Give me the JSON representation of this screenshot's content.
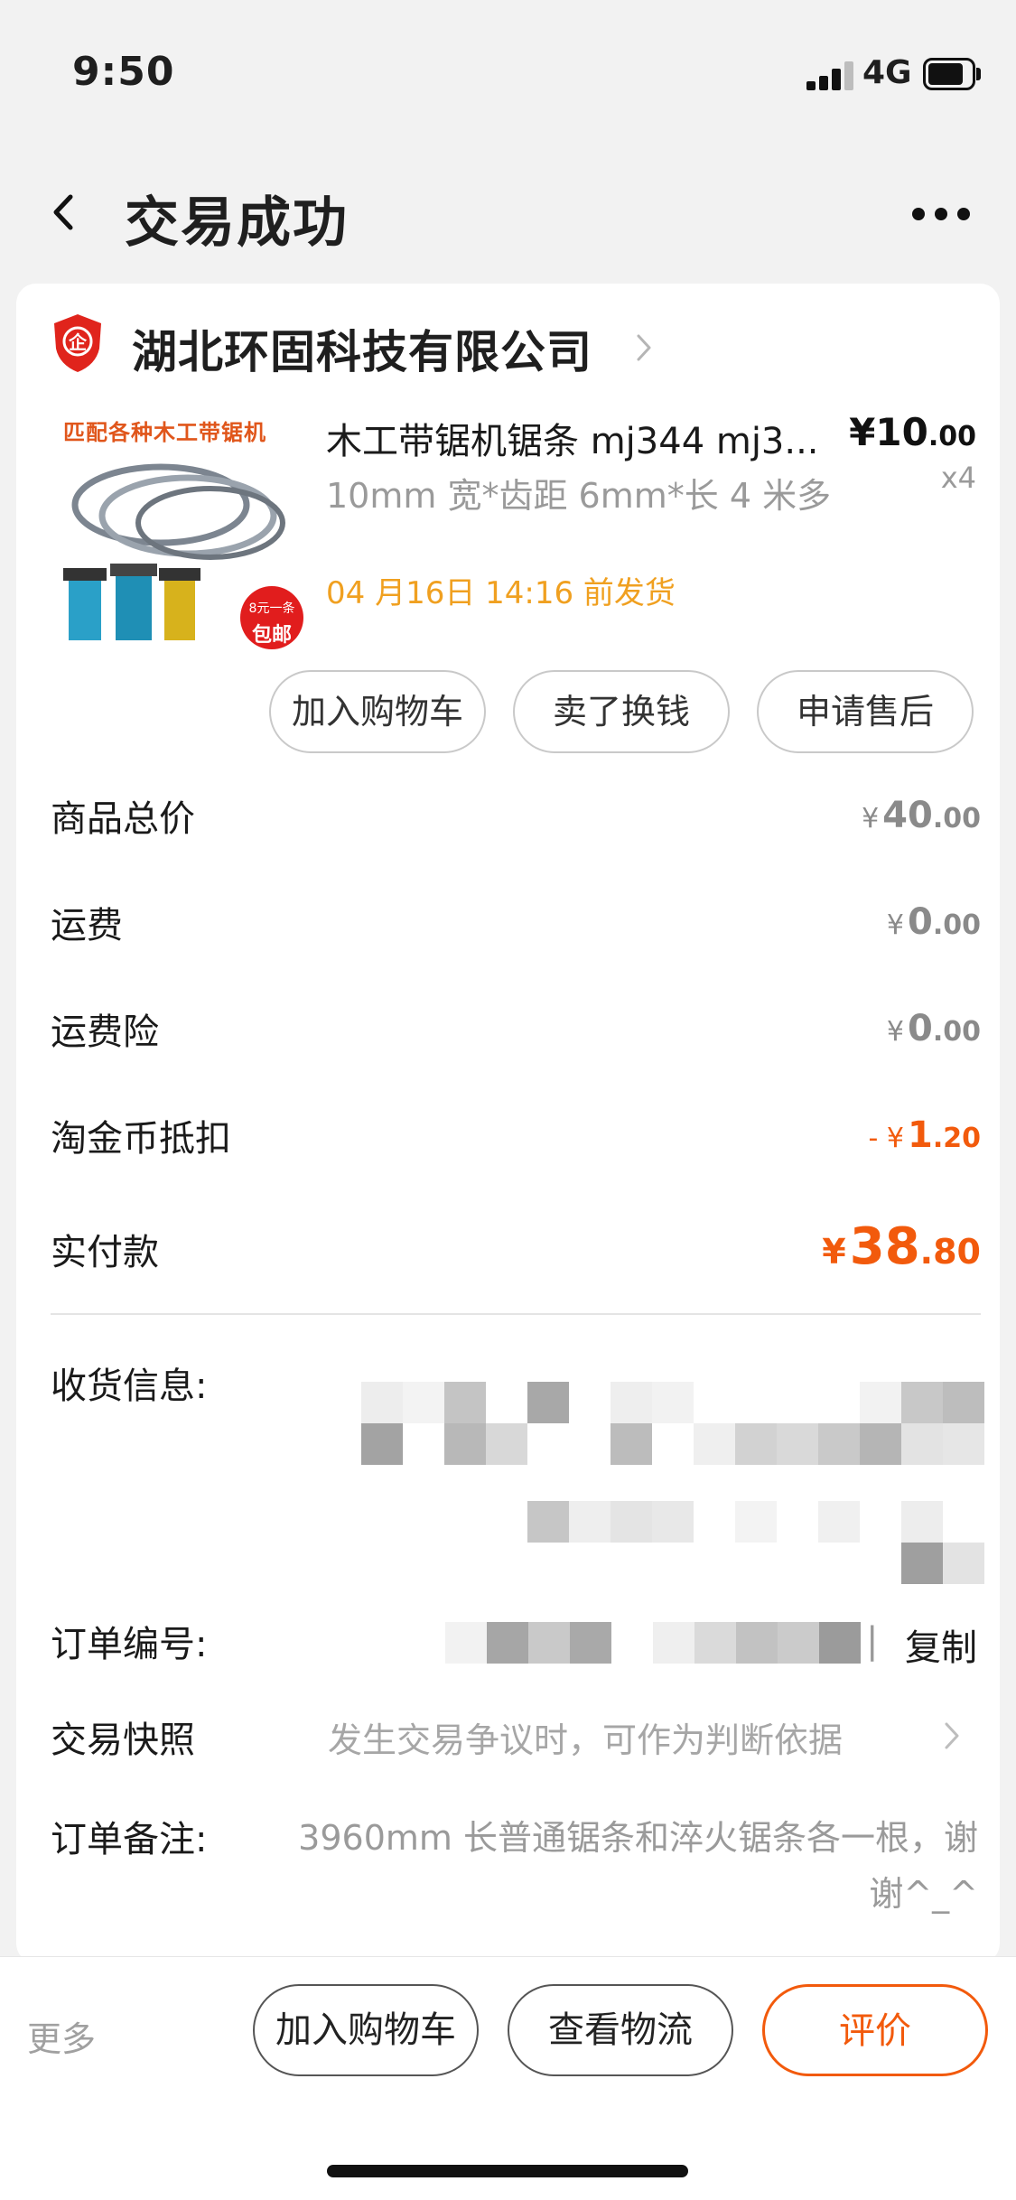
{
  "status_bar": {
    "time": "9:50",
    "network": "4G"
  },
  "nav": {
    "title": "交易成功"
  },
  "shop": {
    "name": "湖北环固科技有限公司"
  },
  "product": {
    "thumb_banner": "匹配各种木工带锯机",
    "thumb_badge_line1": "8元一条",
    "thumb_badge_line2": "包邮",
    "title": "木工带锯机锯条 mj344 mj3...",
    "spec": "10mm 宽*齿距 6mm*长 4 米多",
    "ship": "04 月16日 14:16 前发货",
    "price_int": "¥10",
    "price_dec": ".00",
    "qty": "x4",
    "actions": [
      "加入购物车",
      "卖了换钱",
      "申请售后"
    ]
  },
  "summary": [
    {
      "label": "商品总价",
      "yen": "¥",
      "int": "40",
      "dec": ".00"
    },
    {
      "label": "运费",
      "yen": "¥",
      "int": "0",
      "dec": ".00"
    },
    {
      "label": "运费险",
      "yen": "¥",
      "int": "0",
      "dec": ".00"
    },
    {
      "label": "淘金币抵扣",
      "yen": "- ¥",
      "int": "1",
      "dec": ".20"
    },
    {
      "label": "实付款",
      "yen": "¥",
      "int": "38",
      "dec": ".80"
    }
  ],
  "info": {
    "address_label": "收货信息:",
    "order_no_label": "订单编号:",
    "copy": "复制",
    "separator": "|",
    "snapshot_label": "交易快照",
    "snapshot_text": "发生交易争议时，可作为判断依据",
    "remark_label": "订单备注:",
    "remark_text": "3960mm 长普通锯条和淬火锯条各一根，谢谢^_^"
  },
  "bottom": {
    "more": "更多",
    "add_cart": "加入购物车",
    "logistics": "查看物流",
    "review": "评价"
  },
  "colors": {
    "accent": "#f25a0c",
    "ship_date": "#f0a020",
    "muted": "#9a9a9a",
    "shield_red": "#e0241c"
  }
}
